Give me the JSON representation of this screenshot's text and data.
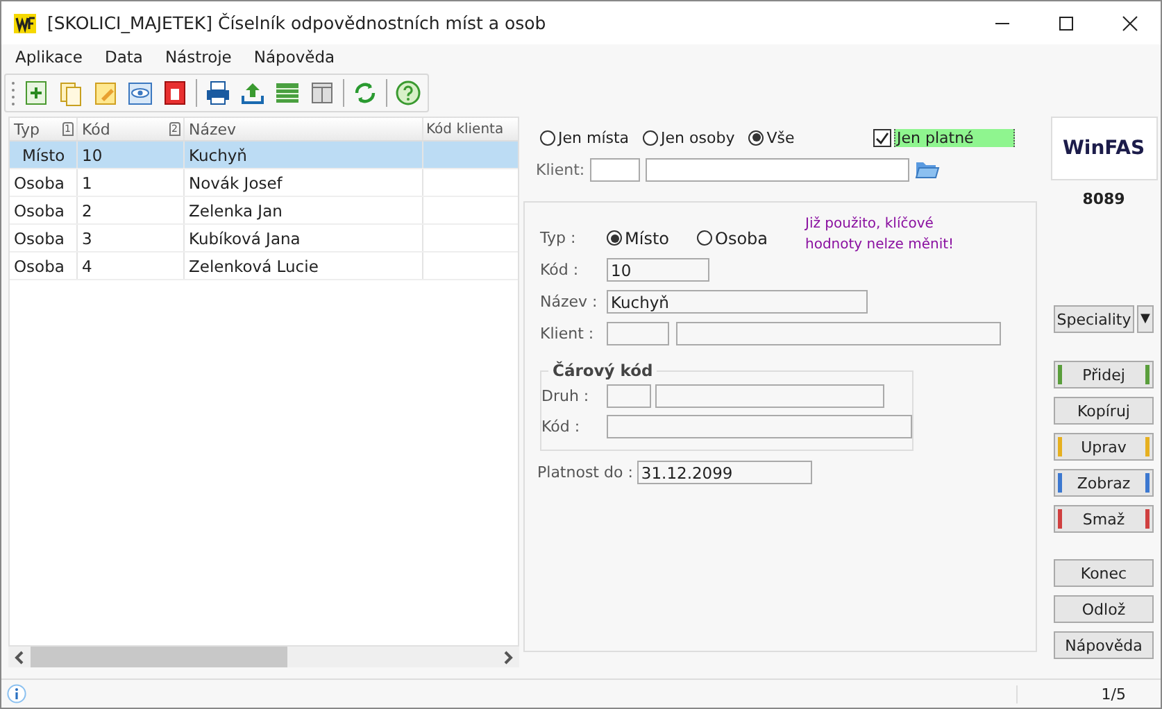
{
  "window": {
    "title": "[SKOLICI_MAJETEK] Číselník odpovědnostních míst a osob"
  },
  "menu": [
    "Aplikace",
    "Data",
    "Nástroje",
    "Nápověda"
  ],
  "toolbar": [
    {
      "kind": "add"
    },
    {
      "kind": "copy"
    },
    {
      "kind": "edit"
    },
    {
      "kind": "view"
    },
    {
      "kind": "delete"
    },
    {
      "kind": "sep"
    },
    {
      "kind": "print"
    },
    {
      "kind": "export"
    },
    {
      "kind": "grid"
    },
    {
      "kind": "columns"
    },
    {
      "kind": "sep"
    },
    {
      "kind": "refresh"
    },
    {
      "kind": "sep"
    },
    {
      "kind": "help"
    }
  ],
  "table": {
    "columns": [
      {
        "label": "Typ",
        "sort_index": "1"
      },
      {
        "label": "Kód",
        "sort_index": "2"
      },
      {
        "label": "Název"
      },
      {
        "label": "Kód klienta"
      }
    ],
    "rows": [
      {
        "cells": [
          "Místo",
          "10",
          "Kuchyň",
          ""
        ],
        "selected": true
      },
      {
        "cells": [
          "Osoba",
          "1",
          "Novák Josef",
          ""
        ],
        "selected": false
      },
      {
        "cells": [
          "Osoba",
          "2",
          "Zelenka Jan",
          ""
        ],
        "selected": false
      },
      {
        "cells": [
          "Osoba",
          "3",
          "Kubíková Jana",
          ""
        ],
        "selected": false
      },
      {
        "cells": [
          "Osoba",
          "4",
          "Zelenková Lucie",
          ""
        ],
        "selected": false
      }
    ]
  },
  "filter": {
    "options": [
      {
        "label": "Jen místa",
        "selected": false
      },
      {
        "label": "Jen osoby",
        "selected": false
      },
      {
        "label": "Vše",
        "selected": true
      }
    ],
    "only_valid": {
      "label": "Jen platné",
      "checked": true
    },
    "client_label": "Klient:"
  },
  "detail": {
    "type_label": "Typ :",
    "types": [
      {
        "label": "Místo",
        "selected": true
      },
      {
        "label": "Osoba",
        "selected": false
      }
    ],
    "warning": "Již použito, klíčové hodnoty nelze měnit!",
    "code_label": "Kód :",
    "code": "10",
    "name_label": "Název :",
    "name": "Kuchyň",
    "client_label": "Klient :",
    "barcode": {
      "title": "Čárový kód",
      "kind_label": "Druh :",
      "code_label": "Kód :"
    },
    "valid_label": "Platnost do :",
    "valid_until": "31.12.2099"
  },
  "side": {
    "logo": "WinFAS",
    "number": "8089",
    "speciality": "Speciality",
    "dropdown": "▼",
    "actions": [
      {
        "label": "Přidej",
        "color": "#5a9e3c"
      },
      {
        "label": "Kopíruj"
      },
      {
        "label": "Uprav",
        "color": "#e6b020"
      },
      {
        "label": "Zobraz",
        "color": "#3c78d0"
      },
      {
        "label": "Smaž",
        "color": "#d04040"
      }
    ],
    "nav": [
      "Konec",
      "Odlož",
      "Nápověda"
    ]
  },
  "status_bar": {
    "position": "1/5"
  }
}
